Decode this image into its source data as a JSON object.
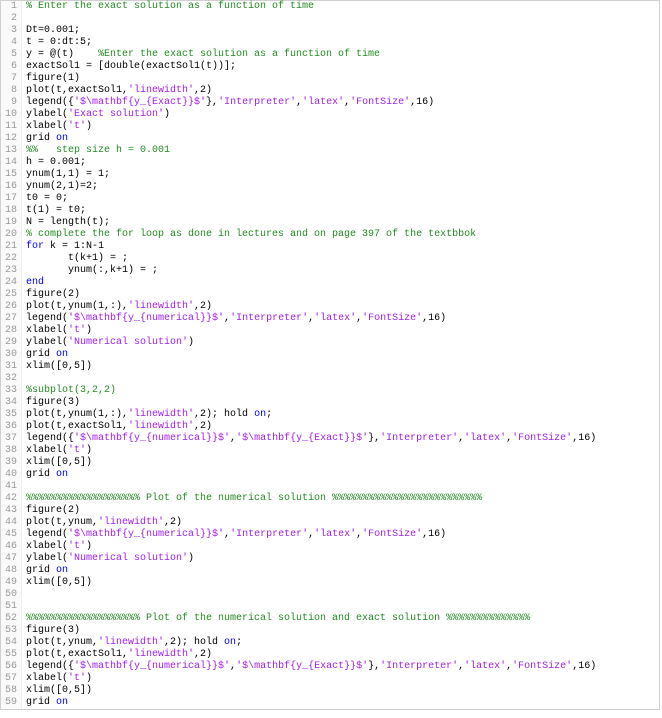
{
  "lines": [
    {
      "n": 1,
      "tokens": [
        {
          "t": "% Enter the exact solution as a function of time",
          "c": "comment"
        }
      ]
    },
    {
      "n": 2,
      "tokens": []
    },
    {
      "n": 3,
      "tokens": [
        {
          "t": "Dt=0.001;",
          "c": "plain"
        }
      ]
    },
    {
      "n": 4,
      "tokens": [
        {
          "t": "t = 0:dt:5;",
          "c": "plain"
        }
      ]
    },
    {
      "n": 5,
      "tokens": [
        {
          "t": "y = @(t)    ",
          "c": "plain"
        },
        {
          "t": "%Enter the exact solution as a function of time",
          "c": "comment"
        }
      ]
    },
    {
      "n": 6,
      "tokens": [
        {
          "t": "exactSol1 = [double(exactSol1(t))];",
          "c": "plain"
        }
      ]
    },
    {
      "n": 7,
      "tokens": [
        {
          "t": "figure(1)",
          "c": "plain"
        }
      ]
    },
    {
      "n": 8,
      "tokens": [
        {
          "t": "plot(t,exactSol1,",
          "c": "plain"
        },
        {
          "t": "'linewidth'",
          "c": "string"
        },
        {
          "t": ",2)",
          "c": "plain"
        }
      ]
    },
    {
      "n": 9,
      "tokens": [
        {
          "t": "legend({",
          "c": "plain"
        },
        {
          "t": "'$\\mathbf{y_{Exact}}$'",
          "c": "string"
        },
        {
          "t": "},",
          "c": "plain"
        },
        {
          "t": "'Interpreter'",
          "c": "string"
        },
        {
          "t": ",",
          "c": "plain"
        },
        {
          "t": "'latex'",
          "c": "string"
        },
        {
          "t": ",",
          "c": "plain"
        },
        {
          "t": "'FontSize'",
          "c": "string"
        },
        {
          "t": ",16)",
          "c": "plain"
        }
      ]
    },
    {
      "n": 10,
      "tokens": [
        {
          "t": "ylabel(",
          "c": "plain"
        },
        {
          "t": "'Exact solution'",
          "c": "string"
        },
        {
          "t": ")",
          "c": "plain"
        }
      ]
    },
    {
      "n": 11,
      "tokens": [
        {
          "t": "xlabel(",
          "c": "plain"
        },
        {
          "t": "'t'",
          "c": "string"
        },
        {
          "t": ")",
          "c": "plain"
        }
      ]
    },
    {
      "n": 12,
      "tokens": [
        {
          "t": "grid ",
          "c": "plain"
        },
        {
          "t": "on",
          "c": "keyword"
        }
      ]
    },
    {
      "n": 13,
      "tokens": [
        {
          "t": "%%   step size h = 0.001",
          "c": "section"
        }
      ]
    },
    {
      "n": 14,
      "tokens": [
        {
          "t": "h = 0.001;",
          "c": "plain"
        }
      ]
    },
    {
      "n": 15,
      "tokens": [
        {
          "t": "ynum(1,1) = 1;",
          "c": "plain"
        }
      ]
    },
    {
      "n": 16,
      "tokens": [
        {
          "t": "ynum(2,1)=2;",
          "c": "plain"
        }
      ]
    },
    {
      "n": 17,
      "tokens": [
        {
          "t": "t0 = 0;",
          "c": "plain"
        }
      ]
    },
    {
      "n": 18,
      "tokens": [
        {
          "t": "t(1) = t0;",
          "c": "plain"
        }
      ]
    },
    {
      "n": 19,
      "tokens": [
        {
          "t": "N = length(t);",
          "c": "plain"
        }
      ]
    },
    {
      "n": 20,
      "tokens": [
        {
          "t": "% complete the for loop as done in lectures and on page 397 of the textbbok",
          "c": "comment"
        }
      ]
    },
    {
      "n": 21,
      "tokens": [
        {
          "t": "for",
          "c": "keyword"
        },
        {
          "t": " k = 1:N-1",
          "c": "plain"
        }
      ]
    },
    {
      "n": 22,
      "tokens": [
        {
          "t": "       t(k+1) = ;",
          "c": "plain"
        }
      ]
    },
    {
      "n": 23,
      "tokens": [
        {
          "t": "       ynum(:,k+1) = ;",
          "c": "plain"
        }
      ]
    },
    {
      "n": 24,
      "tokens": [
        {
          "t": "end",
          "c": "keyword"
        }
      ]
    },
    {
      "n": 25,
      "tokens": [
        {
          "t": "figure(2)",
          "c": "plain"
        }
      ]
    },
    {
      "n": 26,
      "tokens": [
        {
          "t": "plot(t,ynum(1,:),",
          "c": "plain"
        },
        {
          "t": "'linewidth'",
          "c": "string"
        },
        {
          "t": ",2)",
          "c": "plain"
        }
      ]
    },
    {
      "n": 27,
      "tokens": [
        {
          "t": "legend(",
          "c": "plain"
        },
        {
          "t": "'$\\mathbf{y_{numerical}}$'",
          "c": "string"
        },
        {
          "t": ",",
          "c": "plain"
        },
        {
          "t": "'Interpreter'",
          "c": "string"
        },
        {
          "t": ",",
          "c": "plain"
        },
        {
          "t": "'latex'",
          "c": "string"
        },
        {
          "t": ",",
          "c": "plain"
        },
        {
          "t": "'FontSize'",
          "c": "string"
        },
        {
          "t": ",16)",
          "c": "plain"
        }
      ]
    },
    {
      "n": 28,
      "tokens": [
        {
          "t": "xlabel(",
          "c": "plain"
        },
        {
          "t": "'t'",
          "c": "string"
        },
        {
          "t": ")",
          "c": "plain"
        }
      ]
    },
    {
      "n": 29,
      "tokens": [
        {
          "t": "ylabel(",
          "c": "plain"
        },
        {
          "t": "'Numerical solution'",
          "c": "string"
        },
        {
          "t": ")",
          "c": "plain"
        }
      ]
    },
    {
      "n": 30,
      "tokens": [
        {
          "t": "grid ",
          "c": "plain"
        },
        {
          "t": "on",
          "c": "keyword"
        }
      ]
    },
    {
      "n": 31,
      "tokens": [
        {
          "t": "xlim([0,5])",
          "c": "plain"
        }
      ]
    },
    {
      "n": 32,
      "tokens": []
    },
    {
      "n": 33,
      "tokens": [
        {
          "t": "%subplot(3,2,2)",
          "c": "comment"
        }
      ]
    },
    {
      "n": 34,
      "tokens": [
        {
          "t": "figure(3)",
          "c": "plain"
        }
      ]
    },
    {
      "n": 35,
      "tokens": [
        {
          "t": "plot(t,ynum(1,:),",
          "c": "plain"
        },
        {
          "t": "'linewidth'",
          "c": "string"
        },
        {
          "t": ",2); hold ",
          "c": "plain"
        },
        {
          "t": "on",
          "c": "keyword"
        },
        {
          "t": ";",
          "c": "plain"
        }
      ]
    },
    {
      "n": 36,
      "tokens": [
        {
          "t": "plot(t,exactSol1,",
          "c": "plain"
        },
        {
          "t": "'linewidth'",
          "c": "string"
        },
        {
          "t": ",2)",
          "c": "plain"
        }
      ]
    },
    {
      "n": 37,
      "tokens": [
        {
          "t": "legend({",
          "c": "plain"
        },
        {
          "t": "'$\\mathbf{y_{numerical}}$'",
          "c": "string"
        },
        {
          "t": ",",
          "c": "plain"
        },
        {
          "t": "'$\\mathbf{y_{Exact}}$'",
          "c": "string"
        },
        {
          "t": "},",
          "c": "plain"
        },
        {
          "t": "'Interpreter'",
          "c": "string"
        },
        {
          "t": ",",
          "c": "plain"
        },
        {
          "t": "'latex'",
          "c": "string"
        },
        {
          "t": ",",
          "c": "plain"
        },
        {
          "t": "'FontSize'",
          "c": "string"
        },
        {
          "t": ",16)",
          "c": "plain"
        }
      ]
    },
    {
      "n": 38,
      "tokens": [
        {
          "t": "xlabel(",
          "c": "plain"
        },
        {
          "t": "'t'",
          "c": "string"
        },
        {
          "t": ")",
          "c": "plain"
        }
      ]
    },
    {
      "n": 39,
      "tokens": [
        {
          "t": "xlim([0,5])",
          "c": "plain"
        }
      ]
    },
    {
      "n": 40,
      "tokens": [
        {
          "t": "grid ",
          "c": "plain"
        },
        {
          "t": "on",
          "c": "keyword"
        }
      ]
    },
    {
      "n": 41,
      "tokens": []
    },
    {
      "n": 42,
      "tokens": [
        {
          "t": "%%%%%%%%%%%%%%%%%%% Plot of the numerical solution %%%%%%%%%%%%%%%%%%%%%%%%%",
          "c": "comment"
        }
      ]
    },
    {
      "n": 43,
      "tokens": [
        {
          "t": "figure(2)",
          "c": "plain"
        }
      ]
    },
    {
      "n": 44,
      "tokens": [
        {
          "t": "plot(t,ynum,",
          "c": "plain"
        },
        {
          "t": "'linewidth'",
          "c": "string"
        },
        {
          "t": ",2)",
          "c": "plain"
        }
      ]
    },
    {
      "n": 45,
      "tokens": [
        {
          "t": "legend(",
          "c": "plain"
        },
        {
          "t": "'$\\mathbf{y_{numerical}}$'",
          "c": "string"
        },
        {
          "t": ",",
          "c": "plain"
        },
        {
          "t": "'Interpreter'",
          "c": "string"
        },
        {
          "t": ",",
          "c": "plain"
        },
        {
          "t": "'latex'",
          "c": "string"
        },
        {
          "t": ",",
          "c": "plain"
        },
        {
          "t": "'FontSize'",
          "c": "string"
        },
        {
          "t": ",16)",
          "c": "plain"
        }
      ]
    },
    {
      "n": 46,
      "tokens": [
        {
          "t": "xlabel(",
          "c": "plain"
        },
        {
          "t": "'t'",
          "c": "string"
        },
        {
          "t": ")",
          "c": "plain"
        }
      ]
    },
    {
      "n": 47,
      "tokens": [
        {
          "t": "ylabel(",
          "c": "plain"
        },
        {
          "t": "'Numerical solution'",
          "c": "string"
        },
        {
          "t": ")",
          "c": "plain"
        }
      ]
    },
    {
      "n": 48,
      "tokens": [
        {
          "t": "grid ",
          "c": "plain"
        },
        {
          "t": "on",
          "c": "keyword"
        }
      ]
    },
    {
      "n": 49,
      "tokens": [
        {
          "t": "xlim([0,5])",
          "c": "plain"
        }
      ]
    },
    {
      "n": 50,
      "tokens": []
    },
    {
      "n": 51,
      "tokens": []
    },
    {
      "n": 52,
      "tokens": [
        {
          "t": "%%%%%%%%%%%%%%%%%%% Plot of the numerical solution and exact solution %%%%%%%%%%%%%%",
          "c": "comment"
        }
      ]
    },
    {
      "n": 53,
      "tokens": [
        {
          "t": "figure(3)",
          "c": "plain"
        }
      ]
    },
    {
      "n": 54,
      "tokens": [
        {
          "t": "plot(t,ynum,",
          "c": "plain"
        },
        {
          "t": "'linewidth'",
          "c": "string"
        },
        {
          "t": ",2); hold ",
          "c": "plain"
        },
        {
          "t": "on",
          "c": "keyword"
        },
        {
          "t": ";",
          "c": "plain"
        }
      ]
    },
    {
      "n": 55,
      "tokens": [
        {
          "t": "plot(t,exactSol1,",
          "c": "plain"
        },
        {
          "t": "'linewidth'",
          "c": "string"
        },
        {
          "t": ",2)",
          "c": "plain"
        }
      ]
    },
    {
      "n": 56,
      "tokens": [
        {
          "t": "legend({",
          "c": "plain"
        },
        {
          "t": "'$\\mathbf{y_{numerical}}$'",
          "c": "string"
        },
        {
          "t": ",",
          "c": "plain"
        },
        {
          "t": "'$\\mathbf{y_{Exact}}$'",
          "c": "string"
        },
        {
          "t": "},",
          "c": "plain"
        },
        {
          "t": "'Interpreter'",
          "c": "string"
        },
        {
          "t": ",",
          "c": "plain"
        },
        {
          "t": "'latex'",
          "c": "string"
        },
        {
          "t": ",",
          "c": "plain"
        },
        {
          "t": "'FontSize'",
          "c": "string"
        },
        {
          "t": ",16)",
          "c": "plain"
        }
      ]
    },
    {
      "n": 57,
      "tokens": [
        {
          "t": "xlabel(",
          "c": "plain"
        },
        {
          "t": "'t'",
          "c": "string"
        },
        {
          "t": ")",
          "c": "plain"
        }
      ]
    },
    {
      "n": 58,
      "tokens": [
        {
          "t": "xlim([0,5])",
          "c": "plain"
        }
      ]
    },
    {
      "n": 59,
      "tokens": [
        {
          "t": "grid ",
          "c": "plain"
        },
        {
          "t": "on",
          "c": "keyword"
        }
      ]
    }
  ]
}
